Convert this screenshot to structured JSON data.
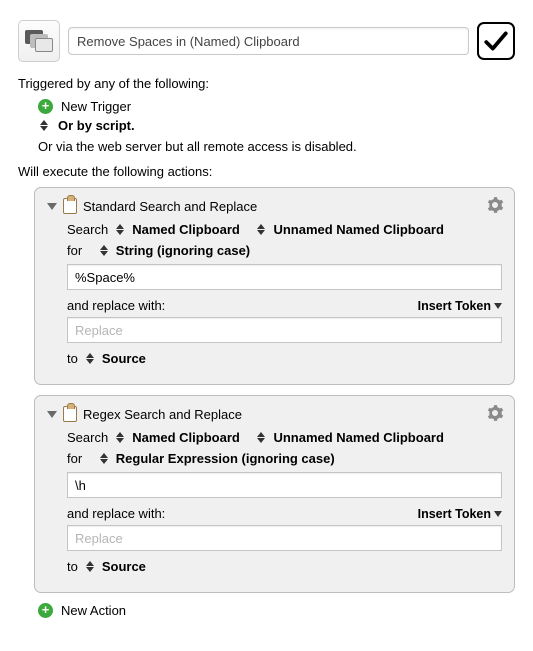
{
  "header": {
    "macro_title": "Remove Spaces in (Named) Clipboard"
  },
  "triggers": {
    "heading": "Triggered by any of the following:",
    "new_trigger_label": "New Trigger",
    "or_by_script_label": "Or by script.",
    "web_server_note": "Or via the web server but all remote access is disabled."
  },
  "actions_heading": "Will execute the following actions:",
  "actions": [
    {
      "title": "Standard Search and Replace",
      "search_label": "Search",
      "target_type": "Named Clipboard",
      "target_value": "Unnamed Named Clipboard",
      "for_label": "for",
      "match_mode": "String (ignoring case)",
      "search_value": "%Space%",
      "replace_label": "and replace with:",
      "insert_token_label": "Insert Token",
      "replace_placeholder": "Replace",
      "replace_value": "",
      "to_label": "to",
      "to_value": "Source"
    },
    {
      "title": "Regex Search and Replace",
      "search_label": "Search",
      "target_type": "Named Clipboard",
      "target_value": "Unnamed Named Clipboard",
      "for_label": "for",
      "match_mode": "Regular Expression (ignoring case)",
      "search_value": "\\h",
      "replace_label": "and replace with:",
      "insert_token_label": "Insert Token",
      "replace_placeholder": "Replace",
      "replace_value": "",
      "to_label": "to",
      "to_value": "Source"
    }
  ],
  "footer": {
    "new_action_label": "New Action"
  }
}
